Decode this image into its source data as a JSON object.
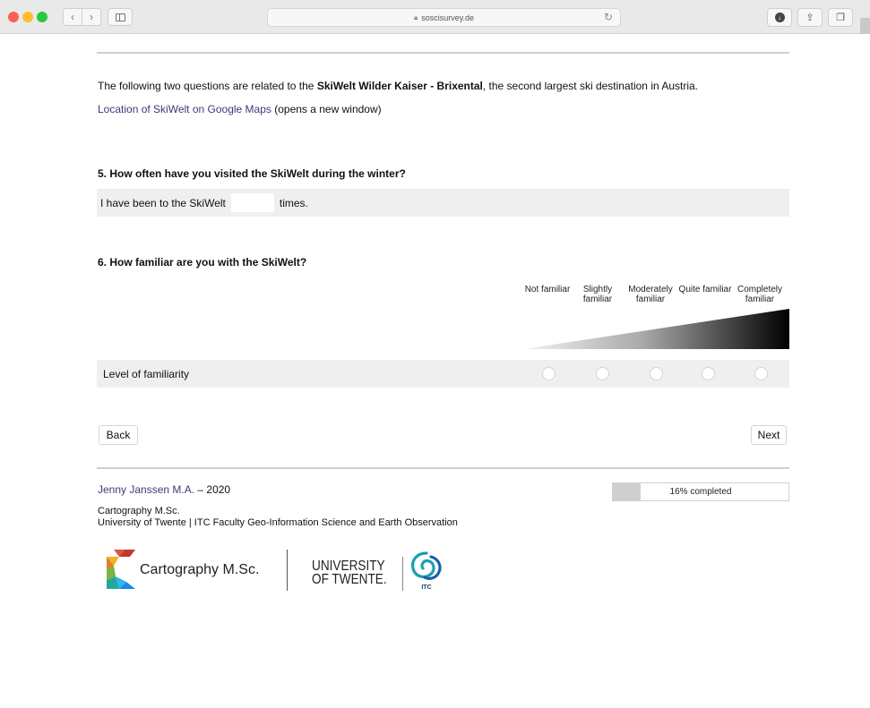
{
  "browser": {
    "url": "soscisurvey.de"
  },
  "intro": {
    "prefix": "The following two questions are related to the ",
    "bold": "SkiWelt Wilder Kaiser - Brixental",
    "suffix": ", the second largest ski destination in Austria.",
    "maps_link": "Location of SkiWelt on Google Maps",
    "maps_note": " (opens a new window)"
  },
  "q5": {
    "title": "5. How often have you visited the SkiWelt during the winter?",
    "before": "I have been to the SkiWelt",
    "after": "times.",
    "value": ""
  },
  "q6": {
    "title": "6. How familiar are you with the SkiWelt?",
    "row_label": "Level of familiarity",
    "scale": [
      "Not familiar",
      "Slightly familiar",
      "Moderately familiar",
      "Quite familiar",
      "Completely familiar"
    ],
    "selected": null
  },
  "nav": {
    "back": "Back",
    "next": "Next"
  },
  "footer": {
    "author_link": "Jenny Janssen M.A.",
    "author_suffix": " – 2020",
    "program": "Cartography M.Sc.",
    "university": "University of Twente | ITC Faculty Geo-Information Science and Earth Observation",
    "progress_percent": 16,
    "progress_text": "16% completed",
    "carto_logo_text": "Cartography M.Sc.",
    "ut_logo_line1": "UNIVERSITY",
    "ut_logo_line2": "OF TWENTE.",
    "itc_logo_text": "ITC"
  },
  "colors": {
    "link": "#3b3b7a",
    "row_bg": "#efefef",
    "progress_fill": "#cfcfcf"
  }
}
